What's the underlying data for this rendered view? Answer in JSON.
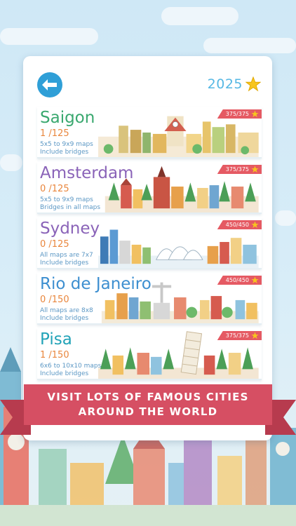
{
  "header": {
    "score": "2025",
    "score_icon": "star-icon",
    "back_icon": "arrow-left-icon"
  },
  "colors": {
    "accent_blue": "#2f9fd7",
    "badge_red": "#e55a63",
    "ribbon_red": "#d64f63",
    "progress_orange": "#e9863d",
    "star_gold": "#f7c51e"
  },
  "cities": [
    {
      "name": "Saigon",
      "name_color": "#3aa86f",
      "progress": "1 /125",
      "line1": "5x5 to 9x9 maps",
      "line2": "Include bridges",
      "stars": "375/375"
    },
    {
      "name": "Amsterdam",
      "name_color": "#8a63b8",
      "progress": "0 /125",
      "line1": "5x5 to 9x9 maps",
      "line2": "Bridges in all maps",
      "stars": "375/375"
    },
    {
      "name": "Sydney",
      "name_color": "#8a63b8",
      "progress": "0 /125",
      "line1": "All maps are 7x7",
      "line2": "Include bridges",
      "stars": "450/450"
    },
    {
      "name": "Rio de Janeiro",
      "name_color": "#3d8fd0",
      "progress": "0 /150",
      "line1": "All maps are 8x8",
      "line2": "Include bridges",
      "stars": "450/450"
    },
    {
      "name": "Pisa",
      "name_color": "#22a3b8",
      "progress": "1 /150",
      "line1": "6x6 to 10x10 maps",
      "line2": "Include bridges",
      "stars": "375/375"
    }
  ],
  "banner": {
    "line1": "VISIT LOTS OF FAMOUS CITIES",
    "line2": "AROUND THE WORLD"
  }
}
